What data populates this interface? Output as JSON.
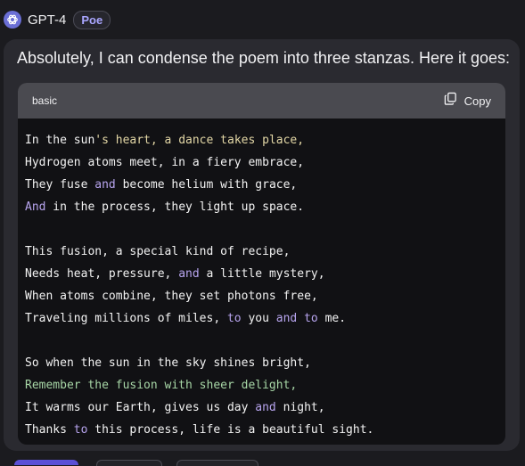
{
  "header": {
    "bot_name": "GPT-4",
    "badge": "Poe"
  },
  "message": {
    "intro": "Absolutely, I can condense the poem into three stanzas. Here it goes:"
  },
  "code_block": {
    "language": "basic",
    "copy_label": "Copy",
    "lines": [
      [
        {
          "t": "In the sun"
        },
        {
          "t": "'s heart, a dance takes place,",
          "c": "str"
        }
      ],
      [
        {
          "t": "Hydrogen atoms meet, in a fiery embrace,"
        }
      ],
      [
        {
          "t": "They fuse "
        },
        {
          "t": "and",
          "c": "kw"
        },
        {
          "t": " become helium with grace,"
        }
      ],
      [
        {
          "t": "And",
          "c": "kw"
        },
        {
          "t": " in the process, they light up space."
        }
      ],
      [],
      [
        {
          "t": "This fusion, a special kind of recipe,"
        }
      ],
      [
        {
          "t": "Needs heat, pressure, "
        },
        {
          "t": "and",
          "c": "kw"
        },
        {
          "t": " a little mystery,"
        }
      ],
      [
        {
          "t": "When atoms combine, they set photons free,"
        }
      ],
      [
        {
          "t": "Traveling millions of miles, "
        },
        {
          "t": "to",
          "c": "kw"
        },
        {
          "t": " you "
        },
        {
          "t": "and",
          "c": "kw"
        },
        {
          "t": " "
        },
        {
          "t": "to",
          "c": "kw"
        },
        {
          "t": " me."
        }
      ],
      [],
      [
        {
          "t": "So when the sun in the sky shines bright,"
        }
      ],
      [
        {
          "t": "Remember the fusion with sheer delight,",
          "c": "fn"
        }
      ],
      [
        {
          "t": "It warms our Earth, gives us day "
        },
        {
          "t": "and",
          "c": "kw"
        },
        {
          "t": " night,"
        }
      ],
      [
        {
          "t": "Thanks "
        },
        {
          "t": "to",
          "c": "kw"
        },
        {
          "t": " this process, life is a beautiful sight."
        }
      ]
    ]
  },
  "colors": {
    "background": "#1b1b1f",
    "bubble": "#2a2a30",
    "code_background": "#111114",
    "code_header": "#4a4a50",
    "accent": "#a9a6ff",
    "bottom_button": "#5a4fd6"
  },
  "icons": {
    "avatar": "openai-logo-icon",
    "copy": "copy-icon"
  }
}
